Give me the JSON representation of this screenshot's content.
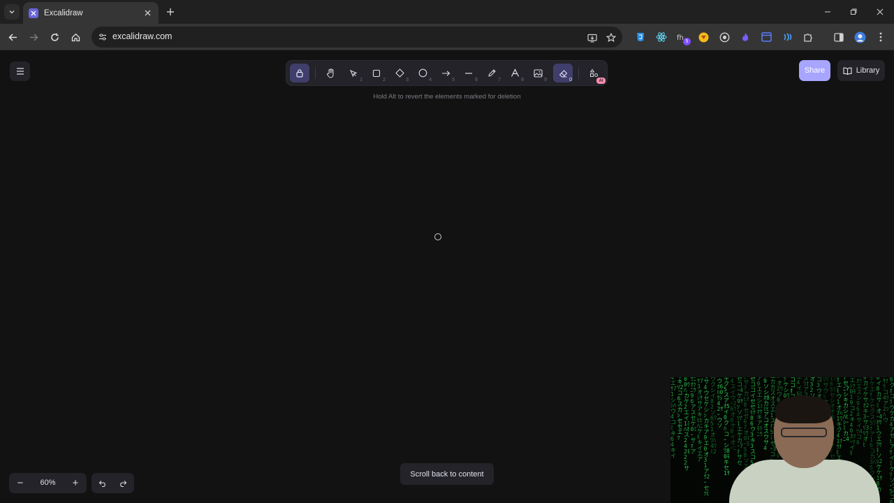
{
  "browser": {
    "tab_title": "Excalidraw",
    "url": "excalidraw.com",
    "extension_badge": "5"
  },
  "excalidraw": {
    "toolbar": {
      "tools": [
        {
          "name": "lock",
          "key": "",
          "active": true
        },
        {
          "name": "hand",
          "key": "",
          "active": false
        },
        {
          "name": "selection",
          "key": "1",
          "active": false
        },
        {
          "name": "rectangle",
          "key": "2",
          "active": false
        },
        {
          "name": "diamond",
          "key": "3",
          "active": false
        },
        {
          "name": "ellipse",
          "key": "4",
          "active": false
        },
        {
          "name": "arrow",
          "key": "5",
          "active": false
        },
        {
          "name": "line",
          "key": "6",
          "active": false
        },
        {
          "name": "draw",
          "key": "7",
          "active": false
        },
        {
          "name": "text",
          "key": "8",
          "active": false
        },
        {
          "name": "image",
          "key": "9",
          "active": false
        },
        {
          "name": "eraser",
          "key": "0",
          "active": true
        },
        {
          "name": "more-tools",
          "key": "",
          "active": false
        }
      ],
      "ai_badge": "AI"
    },
    "hint": "Hold Alt to revert the elements marked for deletion",
    "share_label": "Share",
    "library_label": "Library",
    "zoom": {
      "value": "60%",
      "minus": "−",
      "plus": "+"
    },
    "scroll_back_label": "Scroll back to content"
  },
  "colors": {
    "canvas": "#121212",
    "island": "#232329",
    "accent": "#a8a5ff",
    "active_tool": "#403e6a"
  }
}
